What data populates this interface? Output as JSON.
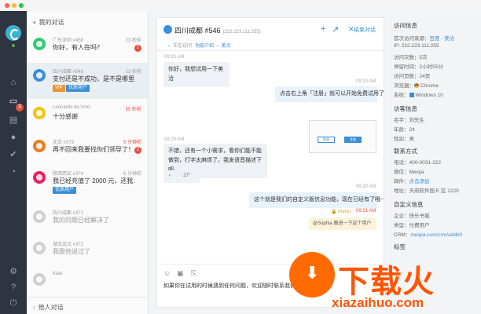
{
  "colors": {
    "rail_bg": "#2e3440",
    "accent": "#3b8fd6",
    "alert": "#e74c3c",
    "online": "#4caf50",
    "tag_vip": "#f0932b",
    "tag_premium": "#3b8fd6",
    "watermark": "#ff5500"
  },
  "rail": {
    "nav_badge": "3",
    "icons": [
      "home-icon",
      "chat-icon",
      "ticket-icon",
      "contacts-icon",
      "check-icon",
      "stats-icon",
      "settings-icon",
      "help-icon",
      "power-icon"
    ]
  },
  "list": {
    "header": "我的对话",
    "footer": "他人对话",
    "items": [
      {
        "name": "广东深圳 #458",
        "time": "23 秒前",
        "msg": "你好，有人在吗？",
        "unread": "1",
        "avatar_color": "#2ecc71"
      },
      {
        "name": "四川成都 #546",
        "time": "23 秒前",
        "msg": "支付还是不成功，是不是哪里出问…",
        "tags": [
          "VIP",
          "优质用户"
        ],
        "avatar_color": "#3b8fd6"
      },
      {
        "name": "Leonardo da Vinci",
        "time": "55 秒前",
        "msg": "十分感谢",
        "avatar_color": "#f1c40f"
      },
      {
        "name": "北京 #373",
        "time": "5 分钟前",
        "msg": "再不回来我要找你们领导了！！",
        "unread": "2",
        "avatar_color": "#e67e22"
      },
      {
        "name": "陕西西安 #374",
        "time": "6 分钟前",
        "msg": "我已经充值了 2000 元，还我…",
        "tags": [
          "优质用户"
        ],
        "avatar_color": "#e91e63"
      },
      {
        "name": "四川成都 #371",
        "time": "",
        "msg": "我的问题已经解决了",
        "avatar_color": "#cfcfcf"
      },
      {
        "name": "湖北武汉 #372",
        "time": "",
        "msg": "我跟他说过了",
        "avatar_color": "#cfcfcf"
      },
      {
        "name": "Kate",
        "time": "",
        "msg": "",
        "avatar_color": "#cfcfcf"
      }
    ]
  },
  "chat": {
    "title": "四川成都 #546",
    "ip": "(222.223.111.255)",
    "end_label": "结束对话",
    "visiting_prefix": "正在访问",
    "visiting_page": "功能介绍 — 美洽",
    "messages": [
      {
        "time": "09:20 AM",
        "text": "你好，我想试用一下美洽"
      },
      {
        "time": "09:20 AM",
        "text": "点击右上角「注册」就可以开始免费试用了"
      },
      {
        "time": "09:20 AM",
        "text": "不错，还有一个小需求，看你们能不能做到，打字太麻烦了，我发语音描述下吧。"
      },
      {
        "voice": "27''"
      },
      {
        "time": "09:20 AM",
        "text": "这个就是我们的自定义版信息功能，现在已经有了哦~"
      },
      {
        "note_author": "Makiu",
        "note_time": "09:21 AM",
        "text": "@Sophia 跟进一下这个用户"
      }
    ],
    "screenshot": {
      "btn1": "登录",
      "btn2": "注册"
    },
    "composer_text": "如果你在试用的时候遇到任何问题，欢迎随时联系我们"
  },
  "info": {
    "visit": {
      "title": "访问信息",
      "first_source_label": "首次访问来源：",
      "first_source": "百度 - 美洽",
      "ip_label": "IP: ",
      "ip": "222.223.111.255",
      "visit_count_label": "访问次数：",
      "visit_count": "5次",
      "stay_label": "停留时间：",
      "stay": "2小时55分",
      "pages_label": "访问页数：",
      "pages": "24页",
      "browser_label": "浏览器：",
      "browser": "Chrome",
      "os_label": "系统：",
      "os": "Windows 10"
    },
    "visitor": {
      "title": "访客信息",
      "name_label": "名字：",
      "name": "刘先生",
      "age_label": "年龄：",
      "age": "24",
      "gender_label": "性别：",
      "gender": "男"
    },
    "contact": {
      "title": "联系方式",
      "phone_label": "电话：",
      "phone": "400-0031-322",
      "wechat_label": "微信：",
      "wechat": "Meiqia",
      "email_label": "邮件：",
      "email": "点击添加",
      "address_label": "地址：",
      "address": "天府软件园 E 区 1220"
    },
    "custom": {
      "title": "自定义信息",
      "company_label": "企业：",
      "company": "快乐书城",
      "type_label": "类型：",
      "type": "付费用户",
      "crm_label": "CRM：",
      "crm": "meiqia.com/crm/a4db0"
    },
    "tags_title": "标签"
  },
  "watermark": {
    "brand": "下载火",
    "url": "xiazaihuo.com"
  }
}
